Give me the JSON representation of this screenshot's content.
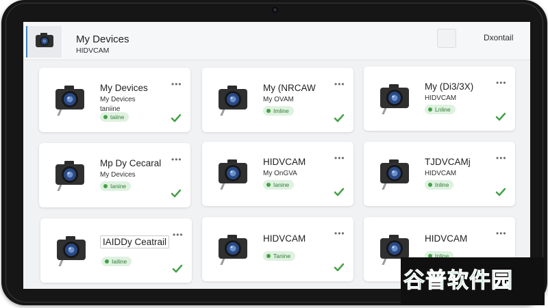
{
  "header": {
    "title": "My Devices",
    "subtitle": "HIDVCAM",
    "action_link": "Dxontail"
  },
  "watermark": {
    "text": "谷普软件园"
  },
  "status_color": "#43a047",
  "cards": [
    {
      "title": "My Devices",
      "subtitle": "My Devices",
      "extra": "taniine",
      "badge": "taiine"
    },
    {
      "title": "My (NRCAW",
      "subtitle": "My OVAM",
      "badge": "Imline"
    },
    {
      "title": "My (Di3/3X)",
      "subtitle": "HIDVCAM",
      "badge": "Lnline"
    },
    {
      "title": "Mp Dy Cecaral",
      "subtitle": "My Devices",
      "badge": "Ianine"
    },
    {
      "title": "HIDVCAM",
      "subtitle": "My OnGVA",
      "badge": "Ianine"
    },
    {
      "title": "TJDVCAMj",
      "subtitle": "HIDVCAM",
      "badge": "Inline"
    },
    {
      "title": "IAIDDy Ceatrail",
      "badge": "Iailine"
    },
    {
      "title": "HIDVCAM",
      "badge": "Tanine"
    },
    {
      "title": "HIDVCAM",
      "badge": "Inline"
    }
  ]
}
